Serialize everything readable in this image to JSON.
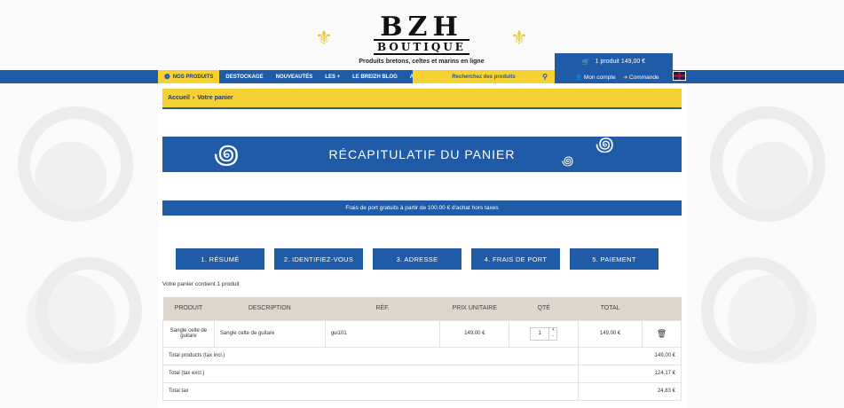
{
  "header": {
    "logo_title": "BZH",
    "logo_sub": "BOUTIQUE",
    "logo_tag": "Produits bretons, celtes et marins en ligne"
  },
  "cart": {
    "summary": "1 produit 149,00 €"
  },
  "nav": {
    "items": [
      {
        "label": "NOS PRODUITS"
      },
      {
        "label": "DESTOCKAGE"
      },
      {
        "label": "NOUVEAUTÉS"
      },
      {
        "label": "LES +"
      },
      {
        "label": "LE BREIZH BLOG"
      },
      {
        "label": "A PROPOS"
      }
    ],
    "search_placeholder": "Recherchez des produits",
    "account": "Mon compte",
    "orders": "Commande"
  },
  "breadcrumb": {
    "home": "Accueil",
    "sep": "›",
    "current": "Votre panier"
  },
  "banner": {
    "title": "RÉCAPITULATIF DU PANIER"
  },
  "shipping_note": "Frais de port gratuits à partir de 100.00 € d'achat hors taxes",
  "steps": [
    "1. RÉSUMÉ",
    "2. IDENTIFIEZ-VOUS",
    "3. ADRESSE",
    "4. FRAIS DE PORT",
    "5. PAIEMENT"
  ],
  "cart_count": "Votre panier contient 1 produit",
  "table": {
    "headers": [
      "PRODUIT",
      "DESCRIPTION",
      "RÉF.",
      "PRIX UNITAIRE",
      "QTÉ",
      "TOTAL"
    ],
    "row": {
      "product": "Sangle celte de guitare",
      "description": "Sangle celte de guitare",
      "ref": "gui101",
      "unit_price": "149,00 €",
      "qty": "1",
      "total": "149,00 €"
    },
    "totals": [
      {
        "label": "Total products (tax incl.)",
        "value": "149,00 €"
      },
      {
        "label": "Total (tax excl.)",
        "value": "124,17 €"
      },
      {
        "label": "Total tax",
        "value": "24,83 €"
      }
    ]
  },
  "colors": {
    "primary": "#1f5ba6",
    "accent": "#f5d133"
  }
}
